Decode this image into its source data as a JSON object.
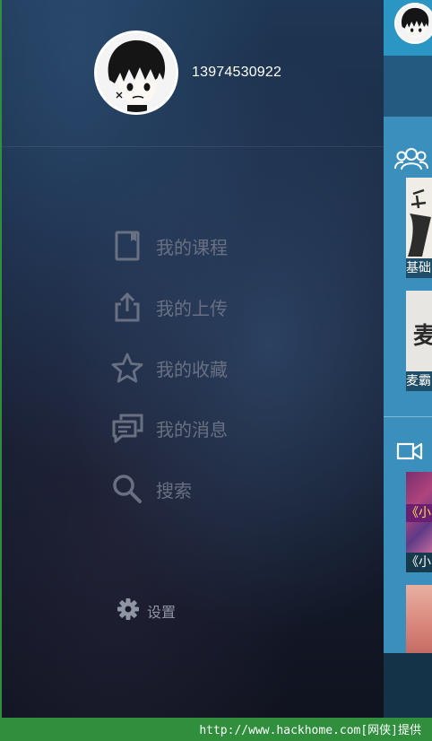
{
  "profile": {
    "phone": "13974530922"
  },
  "menu": [
    {
      "label": "我的课程",
      "icon": "book-icon"
    },
    {
      "label": "我的上传",
      "icon": "upload-icon"
    },
    {
      "label": "我的收藏",
      "icon": "star-icon"
    },
    {
      "label": "我的消息",
      "icon": "message-icon"
    },
    {
      "label": "搜索",
      "icon": "search-icon"
    }
  ],
  "settings": {
    "label": "设置",
    "icon": "gear-icon"
  },
  "right_panel": {
    "section1_icon": "group-icon",
    "cards1": [
      {
        "caption": "基础"
      },
      {
        "caption": "麦霸"
      }
    ],
    "section2_icon": "video-camera-icon",
    "cards2": [
      {
        "caption": "《小"
      }
    ],
    "thumb2_text": "麦",
    "thumb3_text": "《小"
  },
  "watermark": "http://www.hackhome.com[网侠]提供",
  "colors": {
    "menu_text": "#687082",
    "accent": "#2b95c3",
    "footer": "#2f8f3c"
  }
}
